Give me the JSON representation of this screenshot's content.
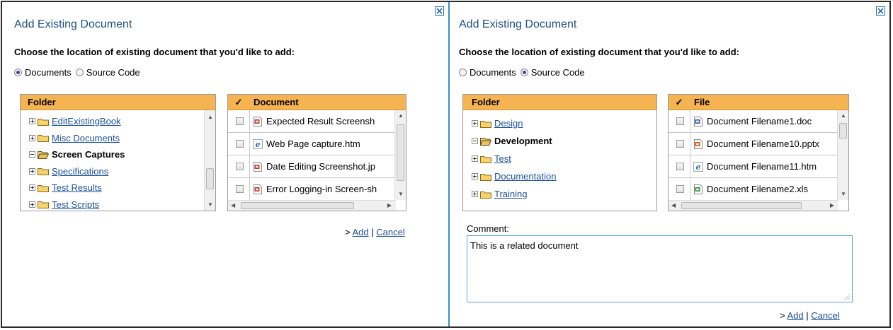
{
  "left": {
    "title": "Add Existing Document",
    "prompt": "Choose the location of existing document that you'd like to add:",
    "radio_documents": "Documents",
    "radio_source": "Source Code",
    "selected_radio": "Documents",
    "folder_header": "Folder",
    "folders": [
      {
        "label": "EditExistingBook",
        "expanded": false,
        "link": true
      },
      {
        "label": "Misc Documents",
        "expanded": false,
        "link": true
      },
      {
        "label": "Screen Captures",
        "expanded": true,
        "link": false
      },
      {
        "label": "Specifications",
        "expanded": false,
        "link": true
      },
      {
        "label": "Test Results",
        "expanded": false,
        "link": true
      },
      {
        "label": "Test Scripts",
        "expanded": false,
        "link": true
      }
    ],
    "check_header": "✓",
    "doc_header": "Document",
    "documents": [
      {
        "name": "Expected Result Screensh",
        "icon": "image-file-icon"
      },
      {
        "name": "Web Page capture.htm",
        "icon": "ie-file-icon"
      },
      {
        "name": "Date Editing Screenshot.jp",
        "icon": "image-file-icon"
      },
      {
        "name": "Error Logging-in Screen-sh",
        "icon": "image-file-icon"
      }
    ],
    "action_prefix": ">",
    "add_label": "Add",
    "separator": "|",
    "cancel_label": "Cancel"
  },
  "right": {
    "title": "Add Existing Document",
    "prompt": "Choose the location of existing document that you'd like to add:",
    "radio_documents": "Documents",
    "radio_source": "Source Code",
    "selected_radio": "Source Code",
    "folder_header": "Folder",
    "folders": [
      {
        "label": "Design",
        "expanded": false,
        "link": true
      },
      {
        "label": "Development",
        "expanded": true,
        "link": false
      },
      {
        "label": "Test",
        "expanded": false,
        "link": true
      },
      {
        "label": "Documentation",
        "expanded": false,
        "link": true
      },
      {
        "label": "Training",
        "expanded": false,
        "link": true
      }
    ],
    "check_header": "✓",
    "file_header": "File",
    "files": [
      {
        "name": "Document Filename1.doc",
        "icon": "word-file-icon"
      },
      {
        "name": "Document Filename10.pptx",
        "icon": "powerpoint-file-icon"
      },
      {
        "name": "Document Filename11.htm",
        "icon": "ie-file-icon"
      },
      {
        "name": "Document Filename2.xls",
        "icon": "excel-file-icon"
      }
    ],
    "comment_label": "Comment:",
    "comment_value": "This is a related document",
    "action_prefix": ">",
    "add_label": "Add",
    "separator": "|",
    "cancel_label": "Cancel"
  },
  "colors": {
    "header_bg": "#f5b351",
    "title": "#1e4f86",
    "link": "#1a4f9c",
    "divider": "#3a8fc8"
  }
}
